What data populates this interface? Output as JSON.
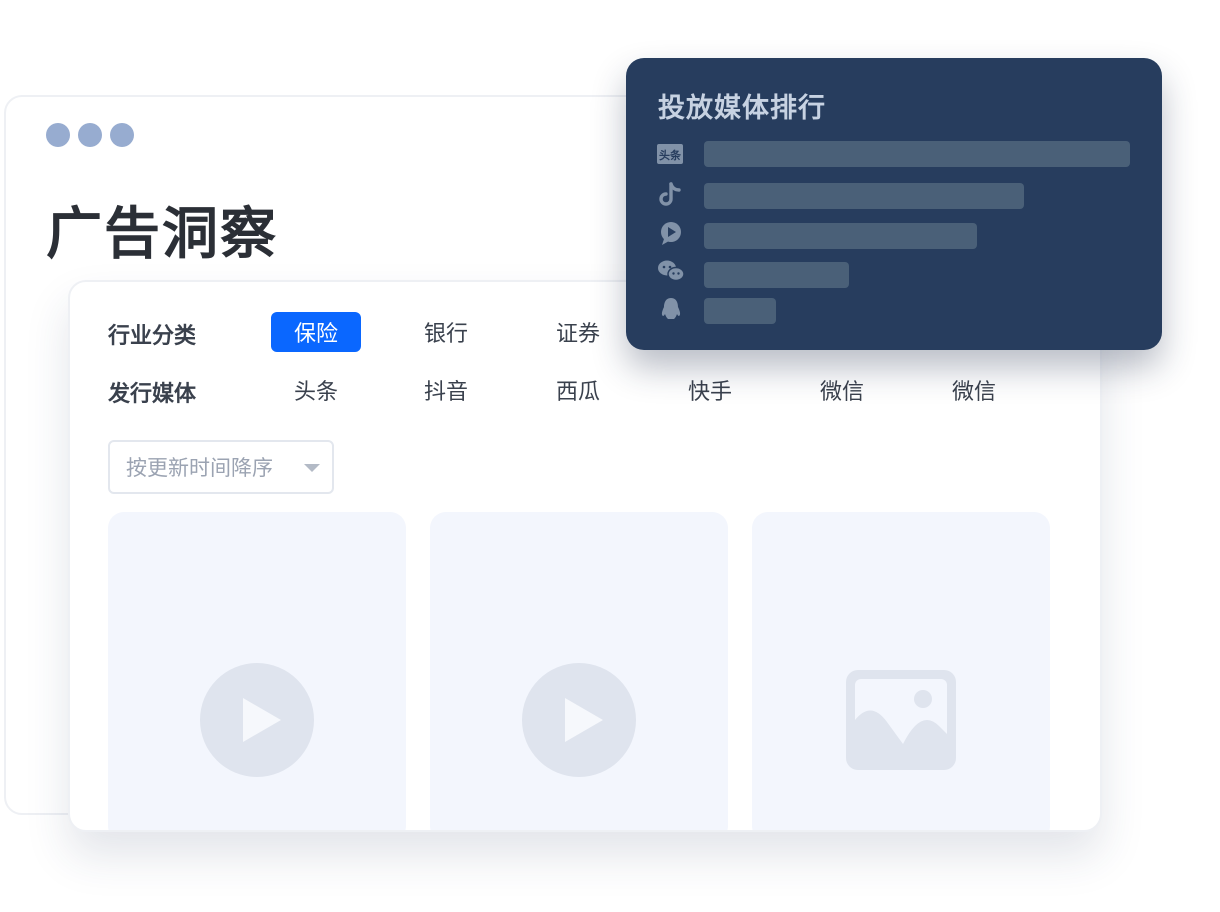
{
  "title": "广告洞察",
  "filters": {
    "industry_label": "行业分类",
    "industry_options": [
      "保险",
      "银行",
      "证券"
    ],
    "industry_selected": "保险",
    "media_label": "发行媒体",
    "media_options": [
      "头条",
      "抖音",
      "西瓜",
      "快手",
      "微信",
      "微信"
    ]
  },
  "sort": {
    "value": "按更新时间降序"
  },
  "cards": [
    {
      "type": "video",
      "icon": "play-icon"
    },
    {
      "type": "video",
      "icon": "play-icon"
    },
    {
      "type": "image",
      "icon": "image-icon"
    }
  ],
  "ranking": {
    "title": "投放媒体排行",
    "items": [
      {
        "icon": "toutiao-icon",
        "icon_text": "头条",
        "share": 1.0
      },
      {
        "icon": "douyin-icon",
        "share": 0.75
      },
      {
        "icon": "xigua-icon",
        "share": 0.64
      },
      {
        "icon": "wechat-icon",
        "share": 0.34
      },
      {
        "icon": "qq-icon",
        "share": 0.17
      }
    ]
  },
  "colors": {
    "accent": "#0a67ff",
    "rank_panel": "#273d5e",
    "rank_bar": "#4a6078",
    "window_dots": "#97acd0",
    "card_bg": "#f3f6fd"
  }
}
